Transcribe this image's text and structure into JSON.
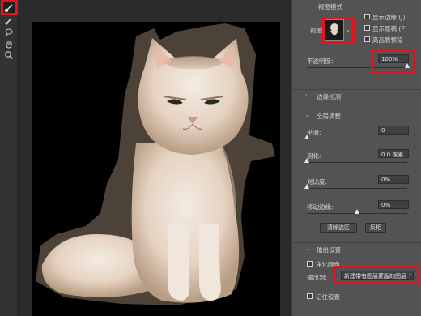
{
  "panel": {
    "view_mode": {
      "header": "视图模式",
      "view_label": "视图:",
      "show_edge": "显示边缘 (J)",
      "show_original": "显示原稿 (P)",
      "high_quality": "高品质预览"
    },
    "opacity": {
      "label": "不透明度:",
      "value": "100%",
      "level": 1.0
    },
    "edge_detection": {
      "title": "边缘检测"
    },
    "global_adjust": {
      "title": "全局调整",
      "smooth": {
        "label": "平滑:",
        "value": "0",
        "level": 0.0
      },
      "feather": {
        "label": "羽化:",
        "value": "0.0 像素",
        "level": 0.0
      },
      "contrast": {
        "label": "对比度:",
        "value": "0%",
        "level": 0.0
      },
      "shift_edge": {
        "label": "移动边缘:",
        "value": "0%",
        "level": 0.5
      },
      "clear_selection": "清除选区",
      "invert": "反相"
    },
    "output": {
      "title": "输出设置",
      "decontaminate": "净化颜色",
      "output_to_label": "输出到:",
      "output_to_value": "新建带有图层蒙版的图层",
      "remember": "记住设置"
    }
  },
  "icons": {
    "quick_select": "quick-select-icon",
    "refine_brush": "refine-edge-brush-icon",
    "lasso": "lasso-icon",
    "hand": "hand-icon",
    "zoom": "zoom-icon",
    "panel_collapse": "chevron-right-icon",
    "panel_expand": "chevron-down-icon",
    "dropdown": "chevron-down-icon"
  },
  "colors": {
    "highlight": "#e0141e",
    "canvas_bg": "#000000",
    "panel_bg": "#535353"
  }
}
